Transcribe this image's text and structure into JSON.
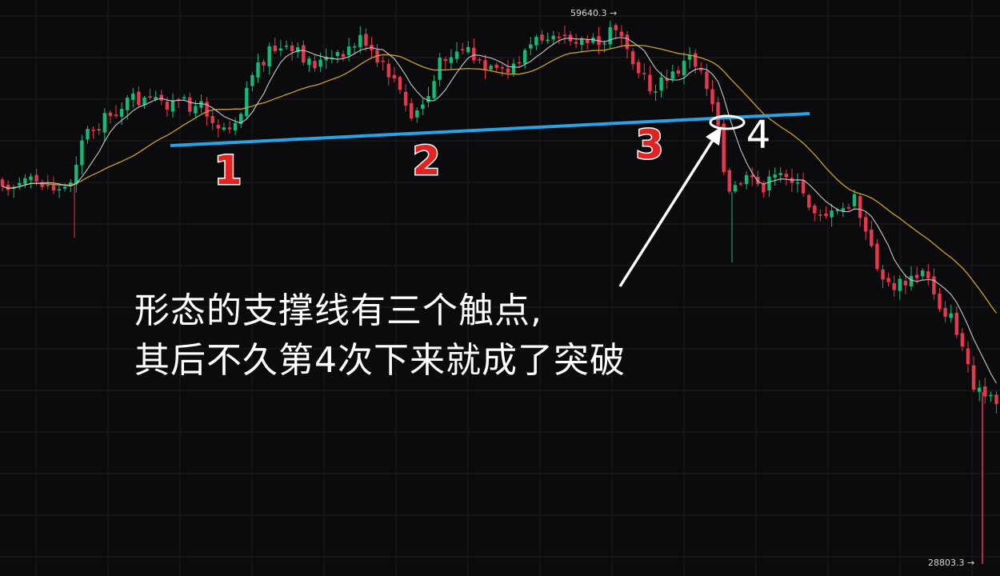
{
  "colors": {
    "background": "#0b0b0d",
    "grid": "#1c1c20",
    "up": "#16b97a",
    "down": "#e8384f",
    "ma_fast": "#c8c8c8",
    "ma_slow": "#c9a227",
    "support_line": "#29a3e6",
    "touch_label": "#e32222",
    "annotation": "#ffffff"
  },
  "annotation": {
    "line1": "形态的支撑线有三个触点,",
    "line2": "其后不久第4次下来就成了突破"
  },
  "chart_data": {
    "type": "candlestick",
    "title": "",
    "xlabel": "",
    "ylabel": "",
    "ylim": [
      28803.3,
      59640.3
    ],
    "price_labels": {
      "high": "59640.3 →",
      "low": "28803.3 →"
    },
    "grid": true,
    "series": [
      {
        "type": "candlestick"
      },
      {
        "type": "moving-average-fast"
      },
      {
        "type": "moving-average-slow"
      }
    ],
    "support_touches": [
      {
        "label": "1",
        "bar": 35
      },
      {
        "label": "2",
        "bar": 66
      },
      {
        "label": "3",
        "bar": 101
      },
      {
        "label": "4",
        "bar": 114,
        "note": "breakout"
      }
    ]
  }
}
